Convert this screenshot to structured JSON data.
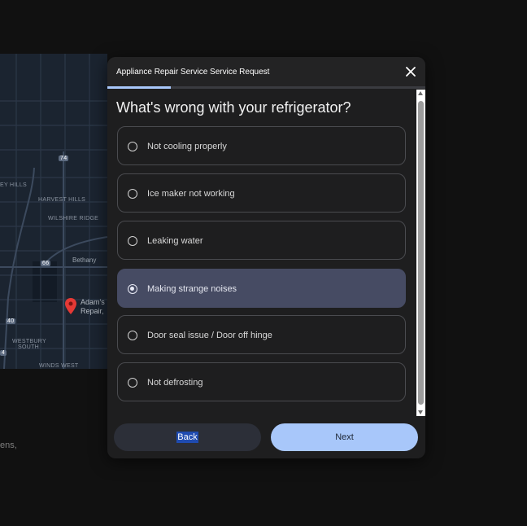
{
  "background": {
    "map": {
      "labels": {
        "hills_partial": "EY HILLS",
        "harvest_hills": "HARVEST HILLS",
        "wilshire_ridge": "WILSHIRE RIDGE",
        "bethany": "Bethany",
        "westbury_south_1": "WESTBURY",
        "westbury_south_2": "SOUTH",
        "winds_west": "WINDS WEST",
        "highway_shield_1": "74",
        "highway_shield_2": "66",
        "highway_shield_3": "40",
        "highway_shield_4": "4",
        "place_name_1": "Adam's",
        "place_name_2": "Repair,"
      },
      "pin_color": "#e53935"
    },
    "partial_text": "ens,"
  },
  "modal": {
    "title": "Appliance Repair Service Service Request",
    "progress_fraction": 0.2,
    "question": "What's wrong with your refrigerator?",
    "options": [
      {
        "label": "Not cooling properly",
        "selected": false
      },
      {
        "label": "Ice maker not working",
        "selected": false
      },
      {
        "label": "Leaking water",
        "selected": false
      },
      {
        "label": "Making strange noises",
        "selected": true
      },
      {
        "label": "Door seal issue / Door off hinge",
        "selected": false
      },
      {
        "label": "Not defrosting",
        "selected": false
      }
    ],
    "back_label": "Back",
    "next_label": "Next",
    "colors": {
      "accent": "#a8c7fa",
      "selected_bg": "#464b63",
      "modal_bg": "#1e1e1f"
    },
    "icons": {
      "close": "close-icon",
      "radio": "radio-icon"
    }
  }
}
